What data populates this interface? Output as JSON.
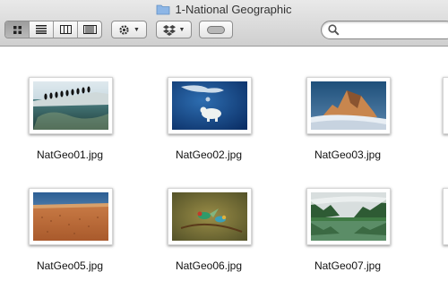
{
  "window": {
    "title": "1-National Geographic"
  },
  "toolbar": {
    "view_modes": [
      "icon-view",
      "list-view",
      "column-view",
      "coverflow-view"
    ],
    "active_view": "icon-view",
    "search": {
      "placeholder": "",
      "value": ""
    }
  },
  "files": [
    {
      "name": "NatGeo01.jpg",
      "scene": "penguins"
    },
    {
      "name": "NatGeo02.jpg",
      "scene": "polar-bear-underwater"
    },
    {
      "name": "NatGeo03.jpg",
      "scene": "mountain-peak"
    },
    {
      "name": "NatGeo05.jpg",
      "scene": "desert-beach"
    },
    {
      "name": "NatGeo06.jpg",
      "scene": "birds"
    },
    {
      "name": "NatGeo07.jpg",
      "scene": "lake-valley"
    }
  ],
  "colors": {
    "accent": "#e6e6e6",
    "folder": "#8db6e6"
  }
}
